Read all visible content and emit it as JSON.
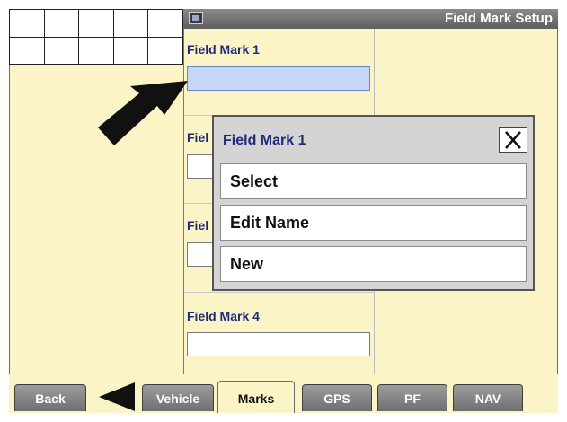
{
  "window": {
    "title": "Field Mark Setup"
  },
  "fields": [
    {
      "label": "Field Mark 1",
      "value": ""
    },
    {
      "label": "Fiel",
      "value": ""
    },
    {
      "label": "Fiel",
      "value": ""
    },
    {
      "label": "Field Mark 4",
      "value": ""
    }
  ],
  "dialog": {
    "title": "Field Mark 1",
    "items": [
      "Select",
      "Edit Name",
      "New"
    ]
  },
  "tabs": [
    "Back",
    "Vehicle",
    "Marks",
    "GPS",
    "PF",
    "NAV"
  ],
  "colors": {
    "background": "#fbf4c7",
    "label": "#1f2a7a",
    "selected_field": "#c6d6f6"
  },
  "icons": {
    "title": "display-icon",
    "pointer": "pointer-arrow-icon",
    "close": "close-icon",
    "back": "back-arrow-icon"
  }
}
